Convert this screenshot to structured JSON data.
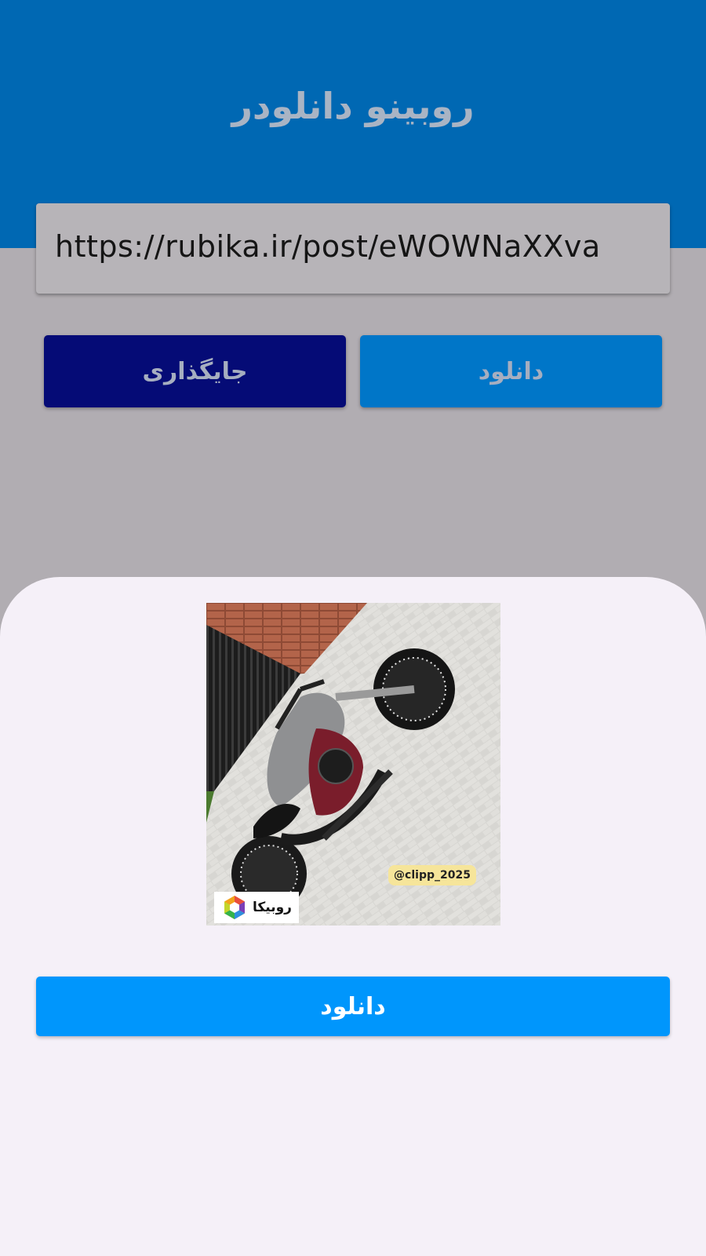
{
  "header": {
    "title": "روبینو دانلودر",
    "color": "#0068b3"
  },
  "url_input": {
    "value": "https://rubika.ir/post/eWOWNaXXva"
  },
  "buttons": {
    "paste_label": "جایگذاری",
    "download_label": "دانلود"
  },
  "preview": {
    "overlay_tag": "@clipp_2025",
    "brand_logo_text": "روبیکا",
    "icon": "motorcycle-photo"
  },
  "sheet": {
    "download_label": "دانلود",
    "accent": "#0096fc"
  }
}
